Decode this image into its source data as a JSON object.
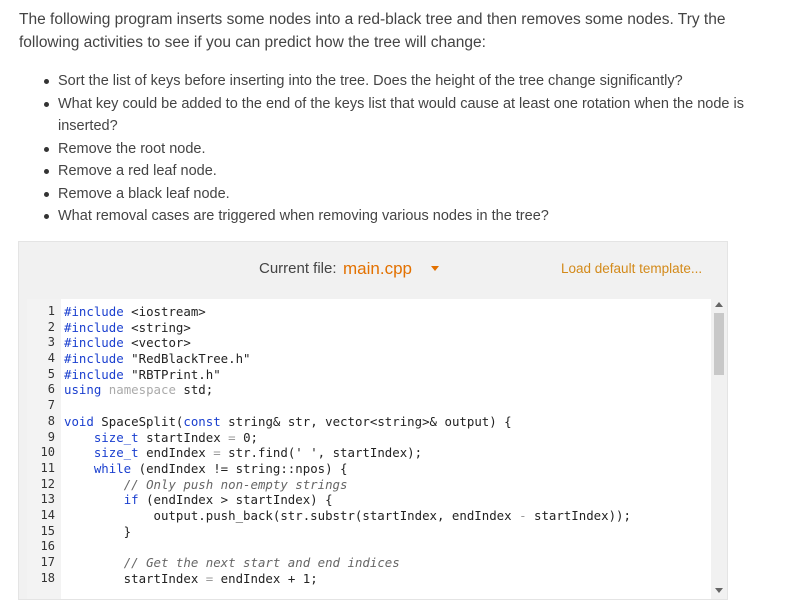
{
  "intro": "The following program inserts some nodes into a red-black tree and then removes some nodes. Try the following activities to see if you can predict how the tree will change:",
  "activities": [
    "Sort the list of keys before inserting into the tree. Does the height of the tree change significantly?",
    "What key could be added to the end of the keys list that would cause at least one rotation when the node is inserted?",
    "Remove the root node.",
    "Remove a red leaf node.",
    "Remove a black leaf node.",
    "What removal cases are triggered when removing various nodes in the tree?"
  ],
  "editor": {
    "current_file_label": "Current file:",
    "current_file": "main.cpp",
    "load_template": "Load default template...",
    "colors": {
      "file_accent": "#e37100",
      "keyword": "#1a3fcf",
      "comment": "#666666"
    },
    "lines": [
      {
        "n": "1",
        "t": [
          [
            "kw",
            "#include"
          ],
          [
            "",
            "<iostream>"
          ]
        ]
      },
      {
        "n": "2",
        "t": [
          [
            "kw",
            "#include"
          ],
          [
            "",
            "<string>"
          ]
        ]
      },
      {
        "n": "3",
        "t": [
          [
            "kw",
            "#include"
          ],
          [
            "",
            "<vector>"
          ]
        ]
      },
      {
        "n": "4",
        "t": [
          [
            "kw",
            "#include"
          ],
          [
            "",
            "\"RedBlackTree.h\""
          ]
        ]
      },
      {
        "n": "5",
        "t": [
          [
            "kw",
            "#include"
          ],
          [
            "",
            "\"RBTPrint.h\""
          ]
        ]
      },
      {
        "n": "6",
        "t": [
          [
            "kw",
            "using"
          ],
          [
            "",
            " "
          ],
          [
            "lt",
            "namespace"
          ],
          [
            "",
            " std;"
          ]
        ]
      },
      {
        "n": "7",
        "t": []
      },
      {
        "n": "8",
        "t": [
          [
            "kw",
            "void"
          ],
          [
            "",
            " SpaceSplit("
          ],
          [
            "kw",
            "const"
          ],
          [
            "",
            " string& str, vector<string>& output) {"
          ]
        ]
      },
      {
        "n": "9",
        "t": [
          [
            "",
            "    "
          ],
          [
            "kw",
            "size_t"
          ],
          [
            "",
            " startIndex "
          ],
          [
            "op",
            "="
          ],
          [
            "",
            " 0;"
          ]
        ]
      },
      {
        "n": "10",
        "t": [
          [
            "",
            "    "
          ],
          [
            "kw",
            "size_t"
          ],
          [
            "",
            " endIndex "
          ],
          [
            "op",
            "="
          ],
          [
            "",
            " str.find(' ', startIndex);"
          ]
        ]
      },
      {
        "n": "11",
        "t": [
          [
            "",
            "    "
          ],
          [
            "kw",
            "while"
          ],
          [
            "",
            " (endIndex != string::npos) {"
          ]
        ]
      },
      {
        "n": "12",
        "t": [
          [
            "",
            "        "
          ],
          [
            "cm",
            "// Only push non-empty strings"
          ]
        ]
      },
      {
        "n": "13",
        "t": [
          [
            "",
            "        "
          ],
          [
            "kw",
            "if"
          ],
          [
            "",
            " (endIndex > startIndex) {"
          ]
        ]
      },
      {
        "n": "14",
        "t": [
          [
            "",
            "            output.push_back(str.substr(startIndex, endIndex "
          ],
          [
            "op",
            "-"
          ],
          [
            "",
            " startIndex));"
          ]
        ]
      },
      {
        "n": "15",
        "t": [
          [
            "",
            "        }"
          ]
        ]
      },
      {
        "n": "16",
        "t": []
      },
      {
        "n": "17",
        "t": [
          [
            "",
            "        "
          ],
          [
            "cm",
            "// Get the next start and end indices"
          ]
        ]
      },
      {
        "n": "18",
        "t": [
          [
            "",
            "        startIndex "
          ],
          [
            "op",
            "="
          ],
          [
            "",
            " endIndex + 1;"
          ]
        ]
      }
    ]
  }
}
